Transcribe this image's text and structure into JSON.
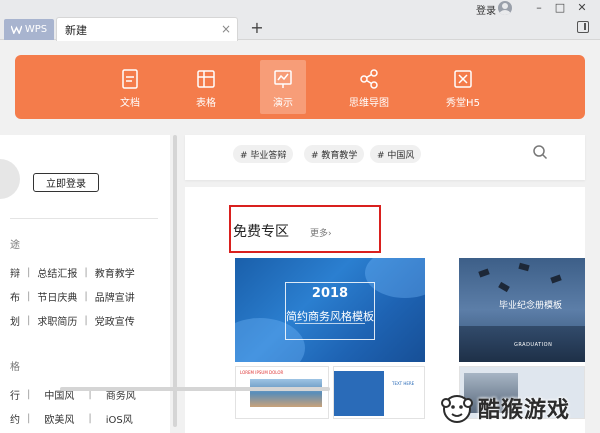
{
  "tabs": {
    "app_label": "WPS",
    "new_tab_label": "新建",
    "close_glyph": "×",
    "add_glyph": "+"
  },
  "window": {
    "login_label": "登录",
    "minimize_glyph": "–",
    "maximize_glyph": "□",
    "close_glyph": "✕"
  },
  "nav": {
    "items": [
      {
        "label": "文档",
        "icon": "document-icon"
      },
      {
        "label": "表格",
        "icon": "spreadsheet-icon"
      },
      {
        "label": "演示",
        "icon": "presentation-icon",
        "active": true
      },
      {
        "label": "思维导图",
        "icon": "mindmap-icon"
      },
      {
        "label": "秀堂H5",
        "icon": "h5-icon"
      }
    ],
    "bar_color": "#f47c4b"
  },
  "sidebar": {
    "login_button": "立即登录",
    "section1_head": "途",
    "rows1": [
      [
        "辩",
        "总结汇报",
        "教育教学"
      ],
      [
        "布",
        "节日庆典",
        "品牌宣讲"
      ],
      [
        "划",
        "求职简历",
        "党政宣传"
      ]
    ],
    "section2_head": "格",
    "rows2": [
      [
        "行",
        "中国风",
        "商务风"
      ],
      [
        "约",
        "欧美风",
        "iOS风"
      ]
    ]
  },
  "search": {
    "tags": [
      "# 毕业答辩",
      "# 教育教学",
      "# 中国风"
    ]
  },
  "free_zone": {
    "title": "免费专区",
    "more_label": "更多",
    "highlight_color": "#d9201e"
  },
  "templates": {
    "card1_year": "2018",
    "card1_title": "简约商务风格模板",
    "card2_title": "毕业纪念册模板",
    "card2_sub": "GRADUATION",
    "mini1_header": "LOREM IPSUM DOLOR",
    "mini2_text": "TEXT HERE"
  },
  "watermark": {
    "text": "酷猴游戏"
  }
}
